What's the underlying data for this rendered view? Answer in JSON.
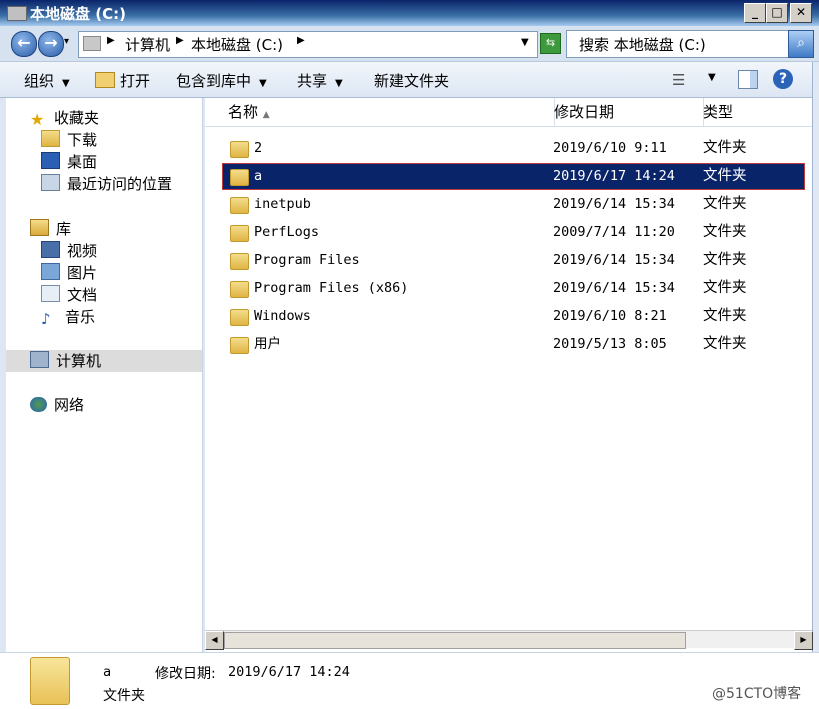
{
  "window": {
    "title": "本地磁盘 (C:)",
    "min": "_",
    "max": "□",
    "close": "✕"
  },
  "address": {
    "crumbs": [
      "计算机",
      "本地磁盘 (C:)"
    ],
    "search_placeholder": "搜索 本地磁盘 (C:)"
  },
  "toolbar": {
    "organize": "组织",
    "open": "打开",
    "include_library": "包含到库中",
    "share": "共享",
    "new_folder": "新建文件夹"
  },
  "nav": {
    "favorites": "收藏夹",
    "downloads": "下载",
    "desktop": "桌面",
    "recent": "最近访问的位置",
    "libraries": "库",
    "videos": "视频",
    "pictures": "图片",
    "documents": "文档",
    "music": "音乐",
    "computer": "计算机",
    "network": "网络"
  },
  "columns": {
    "name": "名称",
    "modified": "修改日期",
    "type": "类型"
  },
  "files": [
    {
      "name": "2",
      "date": "2019/6/10 9:11",
      "type": "文件夹"
    },
    {
      "name": "a",
      "date": "2019/6/17 14:24",
      "type": "文件夹"
    },
    {
      "name": "inetpub",
      "date": "2019/6/14 15:34",
      "type": "文件夹"
    },
    {
      "name": "PerfLogs",
      "date": "2009/7/14 11:20",
      "type": "文件夹"
    },
    {
      "name": "Program Files",
      "date": "2019/6/14 15:34",
      "type": "文件夹"
    },
    {
      "name": "Program Files (x86)",
      "date": "2019/6/14 15:34",
      "type": "文件夹"
    },
    {
      "name": "Windows",
      "date": "2019/6/10 8:21",
      "type": "文件夹"
    },
    {
      "name": "用户",
      "date": "2019/5/13 8:05",
      "type": "文件夹"
    }
  ],
  "details": {
    "name": "a",
    "modified_label": "修改日期:",
    "modified_value": "2019/6/17 14:24",
    "type": "文件夹"
  },
  "watermark": "@51CTO博客"
}
